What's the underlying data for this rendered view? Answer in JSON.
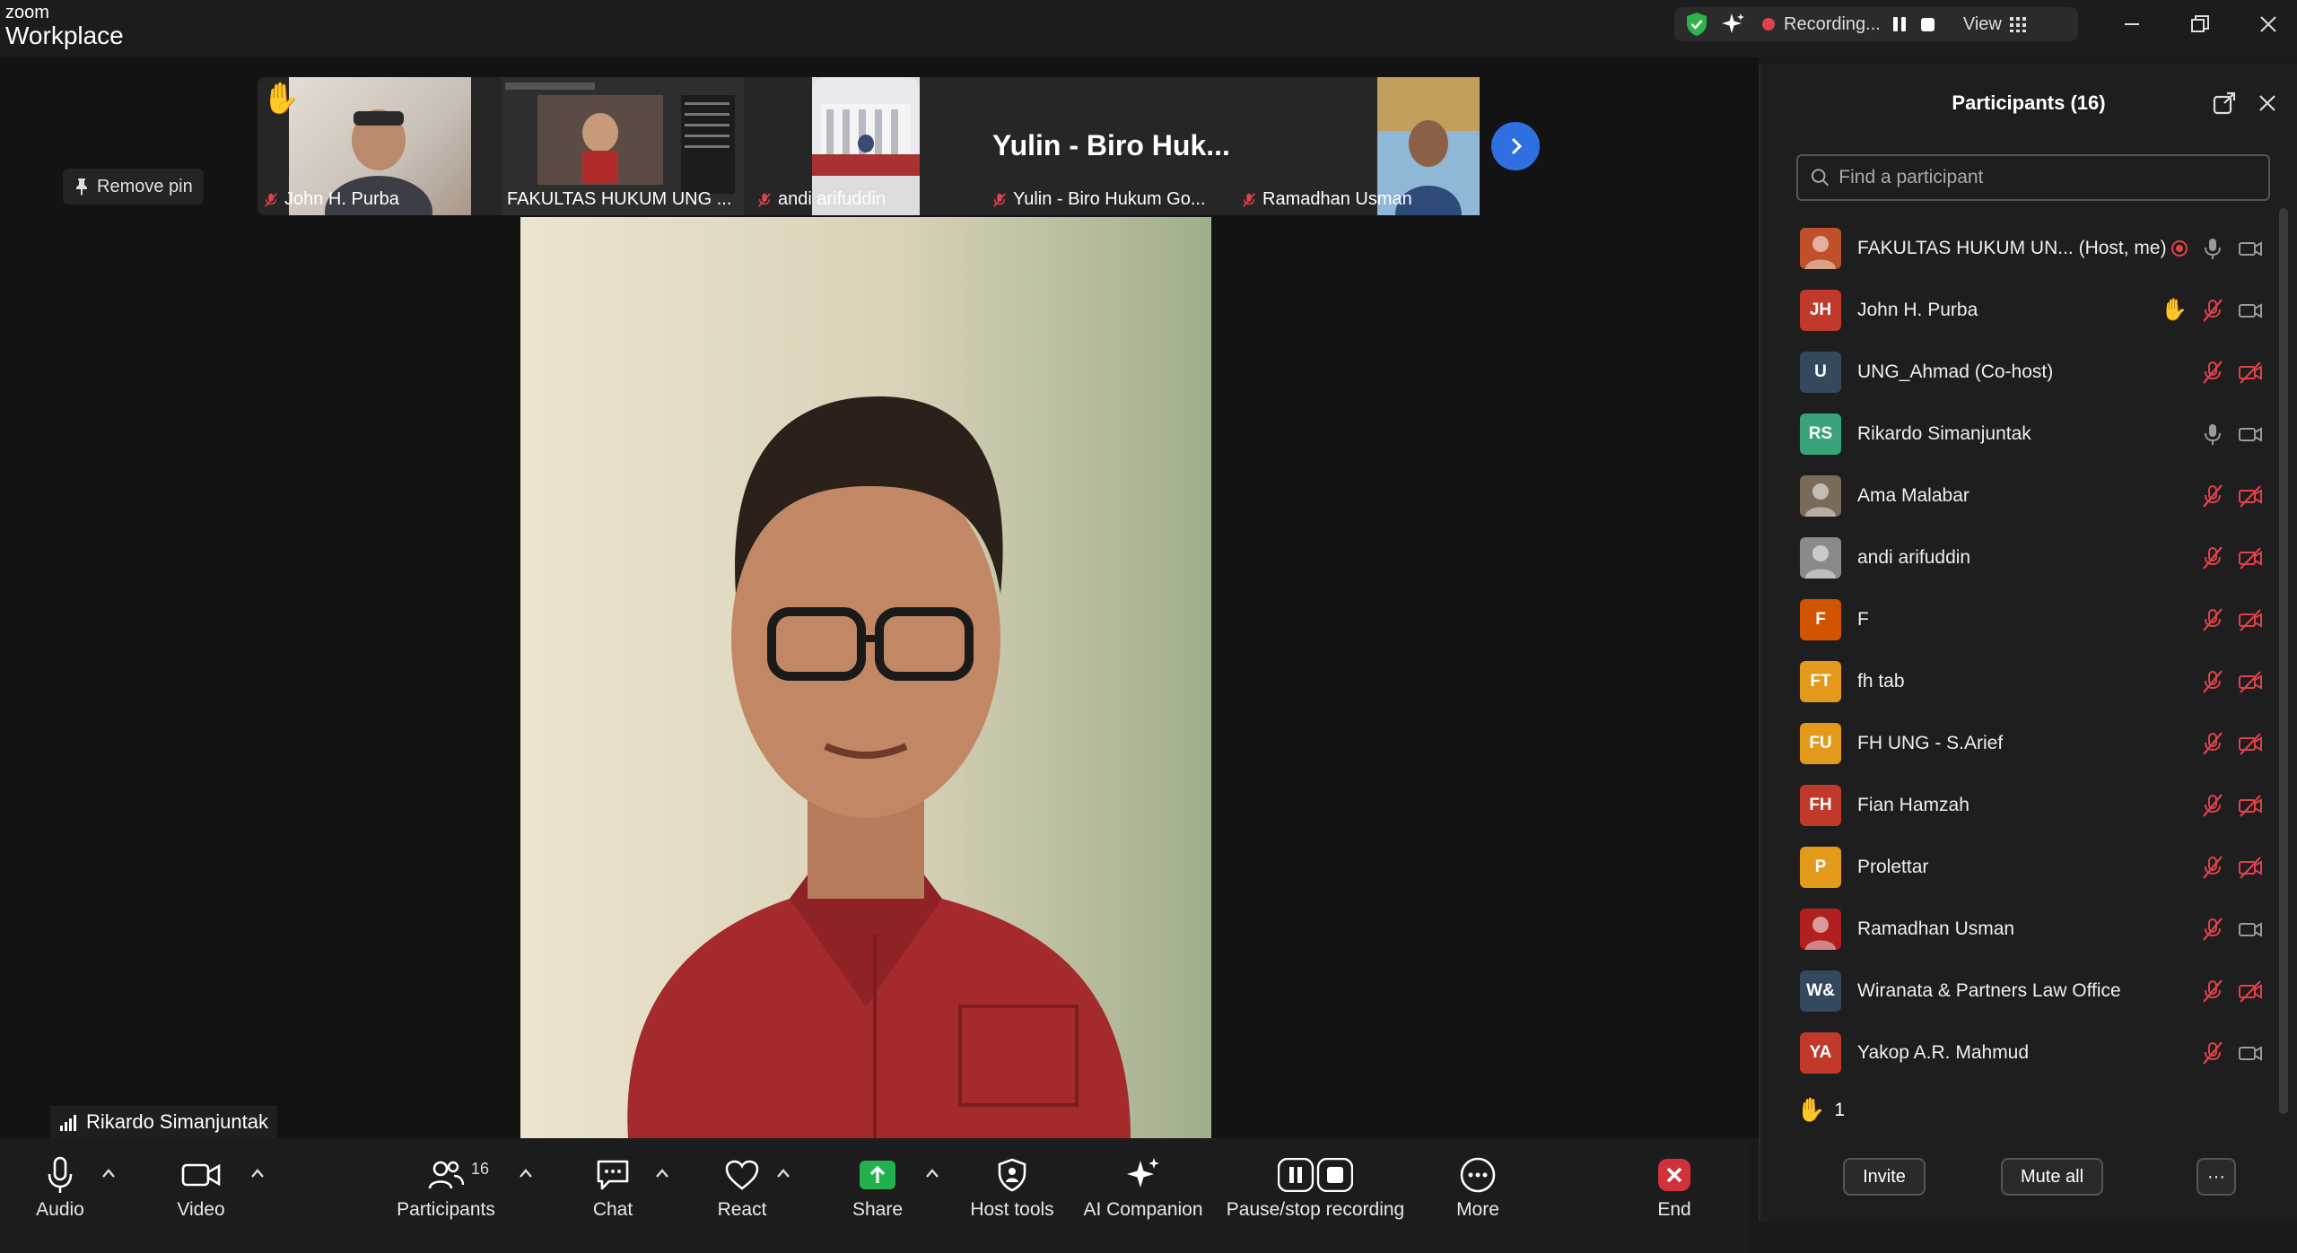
{
  "app": {
    "brand_small": "zoom",
    "brand_large": "Workplace"
  },
  "recording": {
    "status": "Recording...",
    "view_label": "View"
  },
  "strip": {
    "thumbnails": [
      {
        "name": "John H. Purba"
      },
      {
        "name": "FAKULTAS HUKUM UNG ..."
      },
      {
        "name": "andi arifuddin"
      },
      {
        "name": "Yulin - Biro Hukum Go..."
      },
      {
        "name": "Ramadhan Usman"
      }
    ],
    "yulin_big": "Yulin - Biro Huk..."
  },
  "stage": {
    "remove_pin": "Remove pin",
    "speaker": "Rikardo Simanjuntak"
  },
  "toolbar": {
    "audio": "Audio",
    "video": "Video",
    "participants": "Participants",
    "participants_count": "16",
    "chat": "Chat",
    "react": "React",
    "share": "Share",
    "host_tools": "Host tools",
    "ai_companion": "AI Companion",
    "pause_stop": "Pause/stop recording",
    "more": "More",
    "end": "End"
  },
  "panel": {
    "title": "Participants (16)",
    "search_placeholder": "Find a participant",
    "participants": [
      {
        "name": "FAKULTAS HUKUM UN... (Host, me)",
        "initials": "",
        "color": "#c0502a"
      },
      {
        "name": "John H. Purba",
        "initials": "JH",
        "color": "#c0392b"
      },
      {
        "name": "UNG_Ahmad (Co-host)",
        "initials": "U",
        "color": "#34495e"
      },
      {
        "name": "Rikardo Simanjuntak",
        "initials": "RS",
        "color": "#3aa37a"
      },
      {
        "name": "Ama Malabar",
        "initials": "",
        "color": "#7a6a5a"
      },
      {
        "name": "andi arifuddin",
        "initials": "",
        "color": "#8a8a8a"
      },
      {
        "name": "F",
        "initials": "F",
        "color": "#d35400"
      },
      {
        "name": "fh tab",
        "initials": "FT",
        "color": "#e39a1a"
      },
      {
        "name": "FH UNG - S.Arief",
        "initials": "FU",
        "color": "#e39a1a"
      },
      {
        "name": "Fian Hamzah",
        "initials": "FH",
        "color": "#c0392b"
      },
      {
        "name": "Prolettar",
        "initials": "P",
        "color": "#e39a1a"
      },
      {
        "name": "Ramadhan Usman",
        "initials": "",
        "color": "#b02020"
      },
      {
        "name": "Wiranata & Partners Law Office",
        "initials": "W&",
        "color": "#34495e"
      },
      {
        "name": "Yakop A.R. Mahmud",
        "initials": "YA",
        "color": "#c0392b"
      }
    ],
    "raised_hands": "1",
    "invite": "Invite",
    "mute_all": "Mute all",
    "more_dots": "···"
  }
}
